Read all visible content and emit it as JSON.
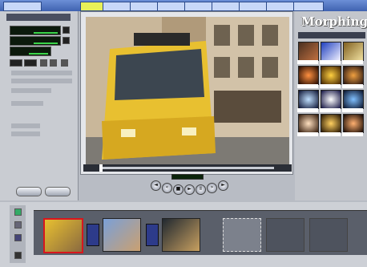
{
  "app": {
    "rightTitle": "Morphing"
  },
  "leftPanel": {
    "title": "",
    "options": [
      "",
      "",
      ""
    ]
  },
  "transport": {
    "timecode": ""
  },
  "bottomButtons": [
    "",
    ""
  ],
  "colors": {
    "accent": "#3f62b0",
    "lcdGreen": "#3bd44a",
    "selectedClip": "#d8161e",
    "transitionBlue": "#2d3b8a"
  },
  "icons": [
    "play-icon",
    "pause-icon",
    "stop-icon",
    "rewind-icon",
    "fast-forward-icon",
    "step-back-icon",
    "step-forward-icon"
  ]
}
